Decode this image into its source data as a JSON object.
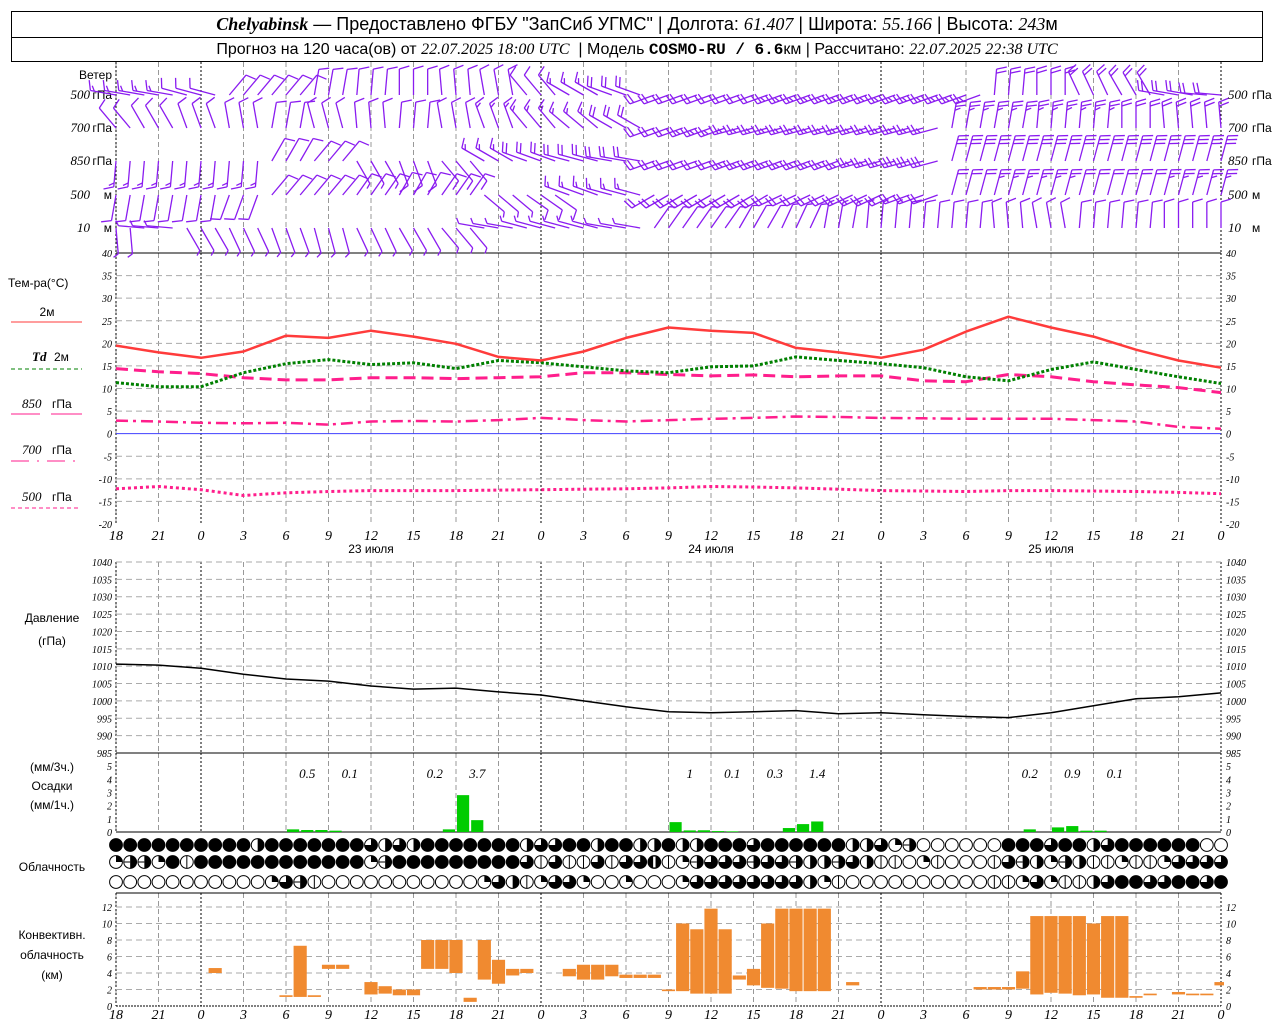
{
  "header": {
    "city": "Chelyabinsk",
    "provider": "— Предоставлено ФГБУ \"ЗапСиб УГМС\"",
    "lon_label": "Долгота:",
    "lon": "61.407",
    "lat_label": "Широта:",
    "lat": "55.166",
    "alt_label": "Высота:",
    "alt": "243",
    "alt_unit": "м",
    "forecast_label": "Прогноз на 120 часа(ов) от",
    "forecast_time": "22.07.2025 18:00 UTC",
    "model_label": "Модель",
    "model": "COSMO-RU / 6.6",
    "model_unit": "км",
    "computed_label": "Рассчитано:",
    "computed_time": "22.07.2025 22:38 UTC"
  },
  "labels": {
    "wind": "Ветер",
    "temp": "Тем-ра(°C)",
    "legend_2m": "2м",
    "legend_td": "Td",
    "legend_td_2m": "2м",
    "legend_850": "850",
    "legend_700": "700",
    "legend_500": "500",
    "legend_hpa": "гПа",
    "pressure": "Давление",
    "pressure_unit": "(гПа)",
    "precip_3h": "(мм/3ч.)",
    "precip": "Осадки",
    "precip_1h": "(мм/1ч.)",
    "cloud": "Облачность",
    "conv1": "Конвективн.",
    "conv2": "облачность",
    "conv3": "(км)"
  },
  "colors": {
    "t2m": "#ff3b3b",
    "td2m": "#008000",
    "t850": "#ff1e8c",
    "t700": "#ff1e8c",
    "t500": "#ff1e8c",
    "zero_line": "#4040ff",
    "wind": "#8a1cf0",
    "precip": "#00cc00",
    "conv": "#f08a30",
    "pressure": "#000000"
  },
  "chart_data": {
    "type": "meteogram",
    "x_hour_labels": [
      "18",
      "21",
      "0",
      "3",
      "6",
      "9",
      "12",
      "15",
      "18",
      "21",
      "0",
      "3",
      "6",
      "9",
      "12",
      "15",
      "18",
      "21",
      "0",
      "3",
      "6",
      "9",
      "12",
      "15",
      "18",
      "21",
      "0"
    ],
    "date_labels": [
      "23 июля",
      "24 июля",
      "25 июля"
    ],
    "wind": {
      "levels": [
        {
          "label_num": "500",
          "label_unit": "гПа",
          "dir": [
            280,
            280,
            285,
            40,
            40,
            10,
            5,
            0,
            355,
            350,
            320,
            300,
            290,
            250,
            250,
            250,
            250,
            250,
            250,
            250,
            250,
            5,
            0,
            335,
            330,
            280,
            275
          ],
          "speed": [
            8,
            8,
            6,
            5,
            5,
            5,
            5,
            5,
            5,
            6,
            6,
            8,
            10,
            12,
            12,
            12,
            13,
            13,
            13,
            14,
            14,
            12,
            12,
            10,
            10,
            12,
            10
          ]
        },
        {
          "label_num": "700",
          "label_unit": "гПа",
          "dir": [
            320,
            330,
            340,
            350,
            10,
            345,
            355,
            5,
            350,
            340,
            320,
            310,
            300,
            250,
            250,
            255,
            255,
            255,
            255,
            255,
            10,
            10,
            5,
            5,
            0,
            355,
            355
          ],
          "speed": [
            5,
            5,
            5,
            6,
            5,
            6,
            6,
            6,
            6,
            8,
            8,
            8,
            10,
            12,
            13,
            13,
            14,
            14,
            14,
            14,
            14,
            14,
            13,
            13,
            12,
            12,
            12
          ]
        },
        {
          "label_num": "850",
          "label_unit": "гПа",
          "dir": [
            185,
            185,
            185,
            185,
            30,
            40,
            150,
            160,
            140,
            300,
            290,
            285,
            280,
            250,
            250,
            250,
            250,
            250,
            255,
            255,
            15,
            15,
            15,
            15,
            15,
            15,
            15
          ],
          "speed": [
            8,
            8,
            8,
            8,
            6,
            6,
            4,
            5,
            5,
            8,
            10,
            12,
            12,
            12,
            12,
            13,
            13,
            14,
            14,
            15,
            15,
            16,
            16,
            16,
            16,
            16,
            16
          ]
        },
        {
          "label_num": "500",
          "label_unit": "м",
          "dir": [
            190,
            190,
            190,
            200,
            40,
            40,
            35,
            30,
            35,
            130,
            125,
            290,
            285,
            240,
            240,
            240,
            245,
            245,
            245,
            250,
            15,
            15,
            15,
            15,
            15,
            15,
            15
          ],
          "speed": [
            6,
            6,
            7,
            7,
            6,
            6,
            5,
            5,
            5,
            4,
            5,
            8,
            9,
            10,
            10,
            10,
            11,
            11,
            11,
            12,
            12,
            13,
            13,
            12,
            12,
            13,
            13
          ]
        },
        {
          "label_num": "10",
          "label_unit": "м",
          "dir": [
            175,
            275,
            150,
            155,
            160,
            165,
            155,
            150,
            140,
            280,
            285,
            285,
            280,
            35,
            35,
            30,
            25,
            10,
            5,
            5,
            5,
            355,
            350,
            5,
            5,
            0,
            0
          ],
          "speed": [
            3,
            4,
            3,
            3,
            3,
            3,
            3,
            3,
            3,
            4,
            4,
            4,
            4,
            4,
            4,
            4,
            4,
            4,
            4,
            5,
            5,
            5,
            5,
            5,
            5,
            5,
            5
          ]
        }
      ]
    },
    "temperature": {
      "ylim": [
        -20,
        40
      ],
      "ticks": [
        40,
        35,
        30,
        25,
        20,
        15,
        10,
        5,
        0,
        -5,
        -10,
        -15,
        -20
      ],
      "t2m": [
        19.5,
        18,
        16.8,
        18.2,
        21.7,
        21.2,
        22.8,
        21.5,
        19.9,
        17,
        16.2,
        18.2,
        21.2,
        23.5,
        22.8,
        22.3,
        19,
        18,
        16.8,
        18.6,
        22.6,
        25.9,
        23.5,
        21.5,
        18.6,
        16.2,
        14.6
      ],
      "td2m": [
        11.3,
        10.4,
        10.4,
        13.5,
        15.5,
        16.4,
        15.3,
        15.7,
        14.4,
        16.2,
        15.7,
        14.8,
        13.9,
        13.5,
        14.8,
        15.0,
        17,
        16.2,
        15.5,
        14.6,
        12.6,
        11.7,
        14.2,
        15.9,
        14.2,
        12.6,
        11.1
      ],
      "t850": [
        14.4,
        13.7,
        13.3,
        12.4,
        11.9,
        11.9,
        12.4,
        12.4,
        12.2,
        12.4,
        12.6,
        13.5,
        13.5,
        13.1,
        12.8,
        13.0,
        12.6,
        12.8,
        12.8,
        11.7,
        11.5,
        13.1,
        12.6,
        11.5,
        10.8,
        10.2,
        9.1
      ],
      "t700": [
        2.9,
        2.7,
        2.4,
        2.3,
        2.4,
        2.0,
        2.7,
        2.8,
        2.7,
        3.0,
        3.5,
        3.0,
        2.7,
        3.0,
        3.3,
        3.5,
        3.8,
        3.7,
        3.5,
        3.4,
        3.3,
        3.3,
        3.3,
        3.0,
        2.7,
        1.5,
        1.1
      ],
      "t500": [
        -12.2,
        -11.7,
        -12.4,
        -13.7,
        -13.1,
        -12.8,
        -12.6,
        -12.6,
        -12.6,
        -12.5,
        -12.4,
        -12.3,
        -12.2,
        -12.0,
        -11.7,
        -11.8,
        -12.0,
        -12.3,
        -12.6,
        -12.7,
        -12.8,
        -12.6,
        -12.6,
        -12.7,
        -12.8,
        -13.0,
        -13.3
      ]
    },
    "pressure": {
      "ylim": [
        985,
        1040
      ],
      "ticks": [
        1040,
        1035,
        1030,
        1025,
        1020,
        1015,
        1010,
        1005,
        1000,
        995,
        990,
        985
      ],
      "values": [
        1010.6,
        1010.3,
        1009.4,
        1007.7,
        1006.3,
        1005.7,
        1004.3,
        1003.4,
        1003.7,
        1002.6,
        1001.7,
        1000,
        998.3,
        996.9,
        996.6,
        996.9,
        997.2,
        996.3,
        996.6,
        996,
        995.5,
        995.2,
        996.6,
        998.6,
        1000.6,
        1001.2,
        1002.3
      ]
    },
    "precipitation": {
      "ylim": [
        0,
        6
      ],
      "ticks": [
        0,
        1,
        2,
        3,
        4,
        5
      ],
      "hourly_mm": [
        0,
        0,
        0,
        0,
        0,
        0,
        0,
        0,
        0,
        0,
        0,
        0,
        0,
        0.2,
        0.15,
        0.15,
        0.1,
        0,
        0,
        0,
        0,
        0,
        0,
        0,
        0.2,
        2.8,
        0.9,
        0,
        0,
        0,
        0,
        0,
        0,
        0,
        0,
        0,
        0,
        0,
        0,
        0,
        0.75,
        0.12,
        0.13,
        0.07,
        0.05,
        0,
        0,
        0,
        0.3,
        0.6,
        0.8,
        0,
        0,
        0,
        0,
        0,
        0,
        0,
        0,
        0,
        0,
        0,
        0,
        0,
        0,
        0.2,
        0,
        0.35,
        0.45,
        0.1,
        0.1,
        0,
        0,
        0,
        0,
        0,
        0,
        0,
        0
      ],
      "totals_3h": [
        "",
        "",
        "",
        "",
        "0.5",
        "0.1",
        "",
        "0.2",
        "3.7",
        "",
        "",
        "",
        "",
        "1",
        "0.1",
        "0.3",
        "1.4",
        "",
        "",
        "",
        "",
        "0.2",
        "0.9",
        "0.1",
        "",
        ""
      ]
    },
    "cloudiness_oktas": [
      "8888888888488888886464888888846688488448448886888888446250000008886884688888800",
      "255281888888888888258888888886161161667125666566544564110210001654254112112666 6",
      "0000000000026510000000000026412662002000266666666421000000000011262114688668868"
    ],
    "convective_cloud": {
      "ylim": [
        0,
        13.5
      ],
      "ticks": [
        0,
        2,
        4,
        6,
        8,
        10,
        12
      ],
      "layers_km": [
        null,
        null,
        null,
        null,
        null,
        null,
        null,
        [
          4,
          4.6
        ],
        null,
        null,
        null,
        null,
        [
          1.1,
          1.3
        ],
        [
          1.1,
          7.3
        ],
        [
          1.1,
          1.3
        ],
        [
          4.5,
          5
        ],
        [
          4.5,
          5
        ],
        null,
        [
          1.4,
          2.9
        ],
        [
          1.5,
          2.4
        ],
        [
          1.3,
          2
        ],
        [
          1.3,
          2
        ],
        [
          4.5,
          8
        ],
        [
          4.5,
          8
        ],
        [
          4,
          8
        ],
        [
          0.5,
          1
        ],
        [
          3.2,
          8
        ],
        [
          2.7,
          5.6
        ],
        [
          3.7,
          4.5
        ],
        [
          4,
          4.5
        ],
        null,
        null,
        [
          3.6,
          4.5
        ],
        [
          3.2,
          5
        ],
        [
          3.2,
          5
        ],
        [
          3.6,
          5
        ],
        [
          3.4,
          3.8
        ],
        [
          3.4,
          3.8
        ],
        [
          3.4,
          3.8
        ],
        [
          1.8,
          2
        ],
        [
          1.8,
          10
        ],
        [
          1.5,
          9.3
        ],
        [
          1.5,
          11.8
        ],
        [
          1.5,
          9.3
        ],
        [
          3.2,
          3.7
        ],
        [
          2.5,
          4.5
        ],
        [
          2.2,
          10
        ],
        [
          2.1,
          11.8
        ],
        [
          1.8,
          11.8
        ],
        [
          1.8,
          11.8
        ],
        [
          1.8,
          11.8
        ],
        null,
        [
          2.5,
          2.9
        ],
        null,
        null,
        null,
        null,
        null,
        null,
        null,
        null,
        [
          2,
          2.3
        ],
        [
          2,
          2.3
        ],
        [
          2,
          2.3
        ],
        [
          2.1,
          4.2
        ],
        [
          1.4,
          10.9
        ],
        [
          1.6,
          10.9
        ],
        [
          1.5,
          10.9
        ],
        [
          1.3,
          10.9
        ],
        [
          1.4,
          10
        ],
        [
          1,
          10.9
        ],
        [
          1,
          10.9
        ],
        [
          1,
          1.2
        ],
        [
          1.3,
          1.5
        ],
        null,
        [
          1.4,
          1.7
        ],
        [
          1.3,
          1.5
        ],
        [
          1.3,
          1.5
        ],
        [
          2.5,
          2.9
        ]
      ]
    }
  }
}
